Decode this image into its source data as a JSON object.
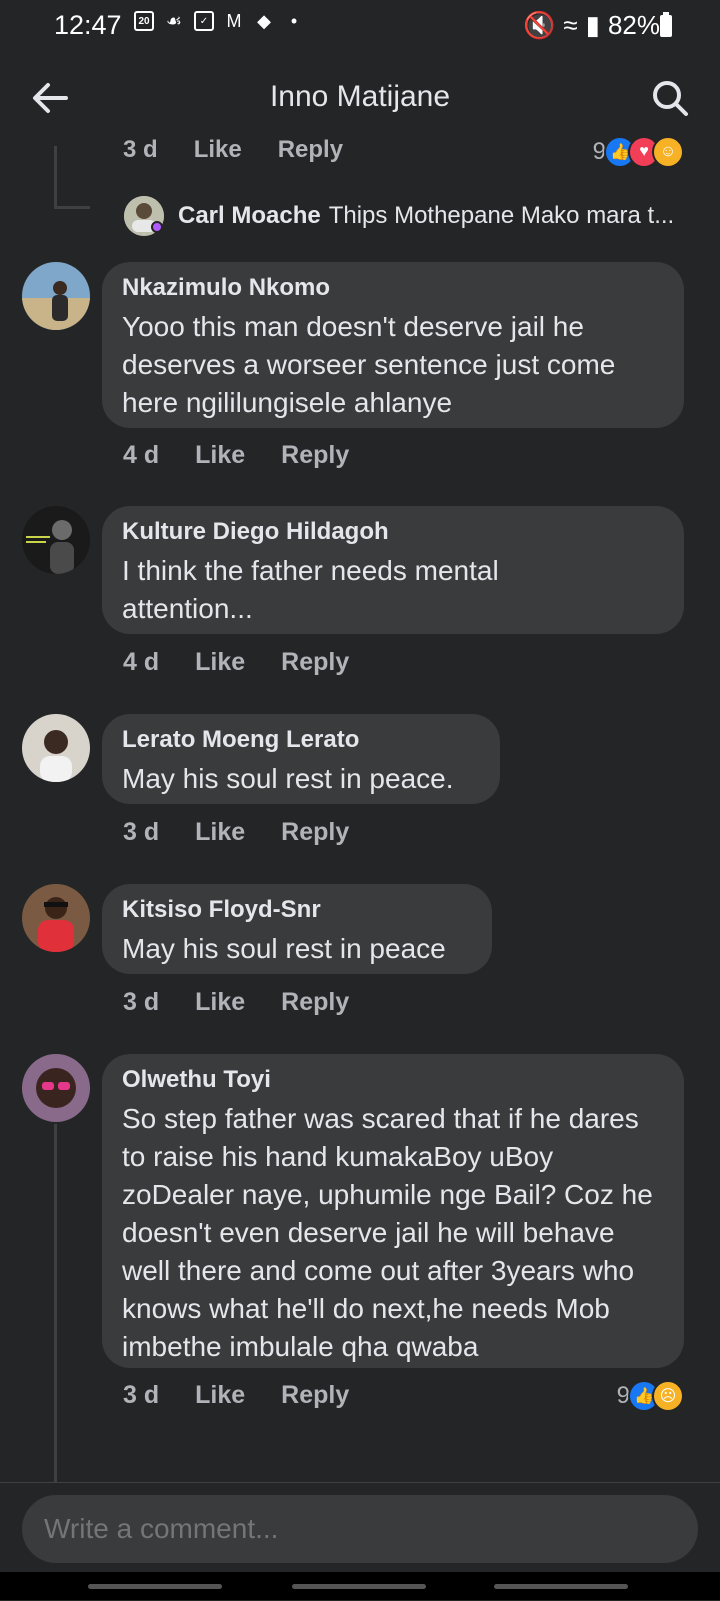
{
  "status_bar": {
    "time": "12:47",
    "calendar_day": "20",
    "battery": "82%"
  },
  "header": {
    "title": "Inno Matijane"
  },
  "top_partial": {
    "time": "3 d",
    "like": "Like",
    "reply": "Reply",
    "reaction_count": "9"
  },
  "reply_preview": {
    "name": "Carl Moache",
    "text": "Thips Mothepane Mako mara t..."
  },
  "comments": [
    {
      "name": "Nkazimulo Nkomo",
      "text": "Yooo this man doesn't deserve jail he deserves a worseer sentence just come here ngililungisele ahlanye",
      "time": "4 d",
      "like": "Like",
      "reply": "Reply"
    },
    {
      "name": "Kulture Diego Hildagoh",
      "text": "I think the father needs mental attention...",
      "time": "4 d",
      "like": "Like",
      "reply": "Reply"
    },
    {
      "name": "Lerato Moeng Lerato",
      "text": "May his soul rest in peace.",
      "time": "3 d",
      "like": "Like",
      "reply": "Reply"
    },
    {
      "name": "Kitsiso Floyd-Snr",
      "text": "May his soul rest in peace",
      "time": "3 d",
      "like": "Like",
      "reply": "Reply"
    },
    {
      "name": "Olwethu Toyi",
      "text": "So step father was scared that if he dares to raise his hand kumakaBoy uBoy zoDealer naye, uphumile nge Bail? Coz he doesn't even deserve jail he will behave well there and come out after 3years who knows what he'll do next,he needs Mob imbethe imbulale qha qwaba",
      "time": "3 d",
      "like": "Like",
      "reply": "Reply",
      "reaction_count": "9"
    }
  ],
  "composer": {
    "placeholder": "Write a comment..."
  },
  "colors": {
    "background": "#242526",
    "bubble": "#3a3b3c",
    "text": "#e4e6eb",
    "secondary_text": "#b0b3b8",
    "like_blue": "#1877f2"
  },
  "icons": [
    "back-arrow-icon",
    "search-icon",
    "like-reaction-icon",
    "love-reaction-icon",
    "care-reaction-icon",
    "sad-reaction-icon"
  ]
}
